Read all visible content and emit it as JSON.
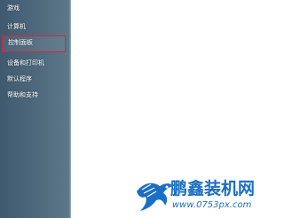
{
  "start_menu": {
    "items": [
      {
        "label": "游戏"
      },
      {
        "label": "计算机"
      },
      {
        "label": "控制面板"
      },
      {
        "label": "设备和打印机"
      },
      {
        "label": "默认程序"
      },
      {
        "label": "帮助和支持"
      }
    ]
  },
  "watermark": {
    "title": "鹏鑫装机网",
    "url": "www.0753px.com"
  },
  "colors": {
    "highlight_border": "#d9233f",
    "watermark_blue": "#1a6fc4"
  }
}
